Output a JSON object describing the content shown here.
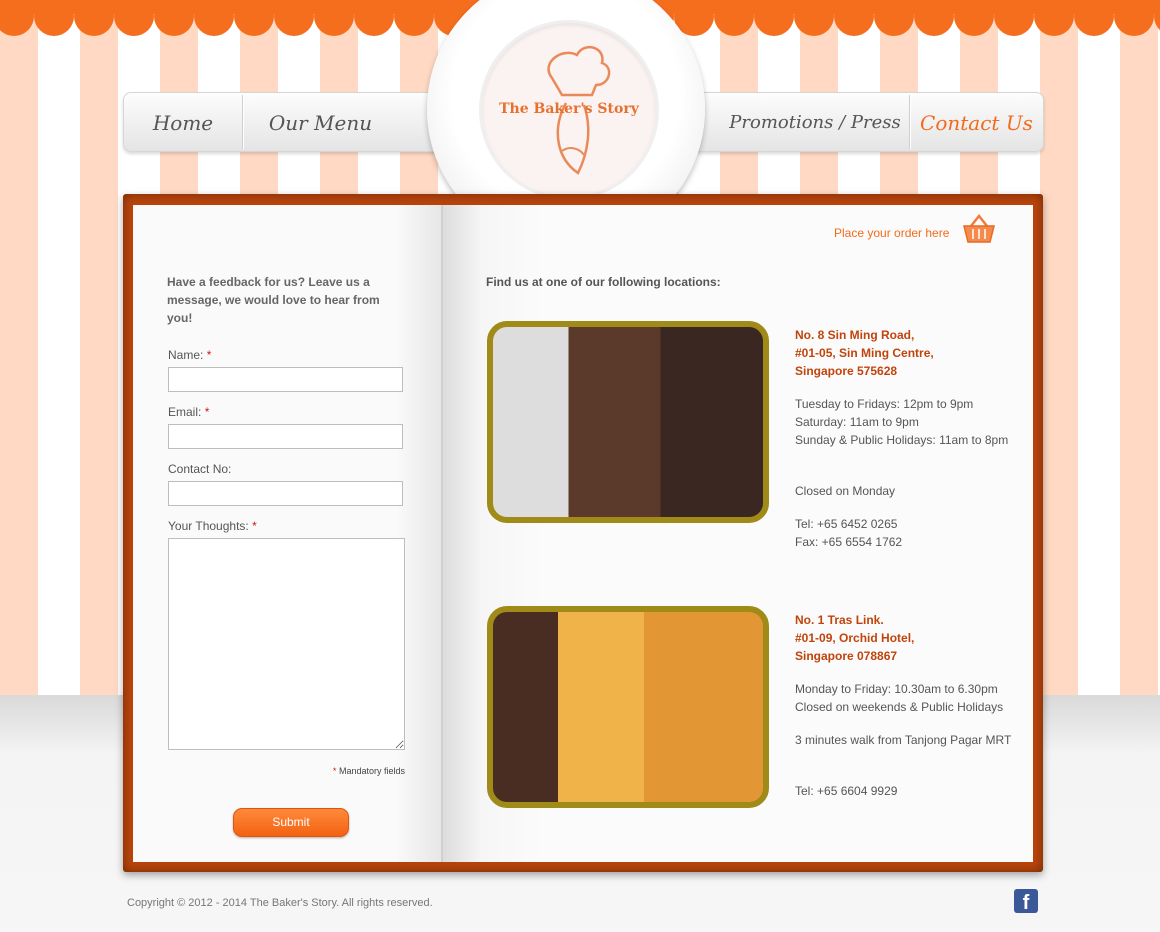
{
  "nav": {
    "home": "Home",
    "menu": "Our Menu",
    "promotions": "Promotions / Press",
    "contact": "Contact Us"
  },
  "logo": {
    "text": "The Baker's Story"
  },
  "order": {
    "label": "Place your order here"
  },
  "feedback": {
    "intro": "Have a feedback for us? Leave us a message, we would love to hear from you!",
    "name_label": "Name:",
    "email_label": "Email:",
    "contact_label": "Contact No:",
    "thoughts_label": "Your Thoughts:",
    "required_mark": "*",
    "mandatory_note": "Mandatory fields",
    "submit_label": "Submit"
  },
  "locations": {
    "heading": "Find us at one of our following locations:",
    "items": [
      {
        "address": [
          "No. 8 Sin Ming Road,",
          "#01-05, Sin Ming Centre,",
          "Singapore 575628"
        ],
        "hours": [
          "Tuesday to Fridays: 12pm to 9pm",
          "Saturday: 11am to 9pm",
          "Sunday & Public Holidays: 11am to 8pm"
        ],
        "closed": "Closed on Monday",
        "tel": "Tel: +65 6452 0265",
        "fax": "Fax: +65 6554 1762"
      },
      {
        "address": [
          "No. 1 Tras Link.",
          "#01-09, Orchid Hotel,",
          "Singapore 078867"
        ],
        "hours": [
          "Monday to Friday: 10.30am to 6.30pm",
          "Closed on weekends & Public Holidays"
        ],
        "walk": "3 minutes walk from Tanjong Pagar MRT",
        "tel": "Tel: +65 6604 9929"
      }
    ]
  },
  "footer": {
    "copyright": "Copyright © 2012 - 2014 The Baker's Story. All rights reserved.",
    "facebook_icon": "facebook-icon"
  },
  "colors": {
    "accent": "#f26b1d",
    "frame": "#b8440c",
    "address": "#c0440c",
    "stripe": "#ffd9c4"
  }
}
